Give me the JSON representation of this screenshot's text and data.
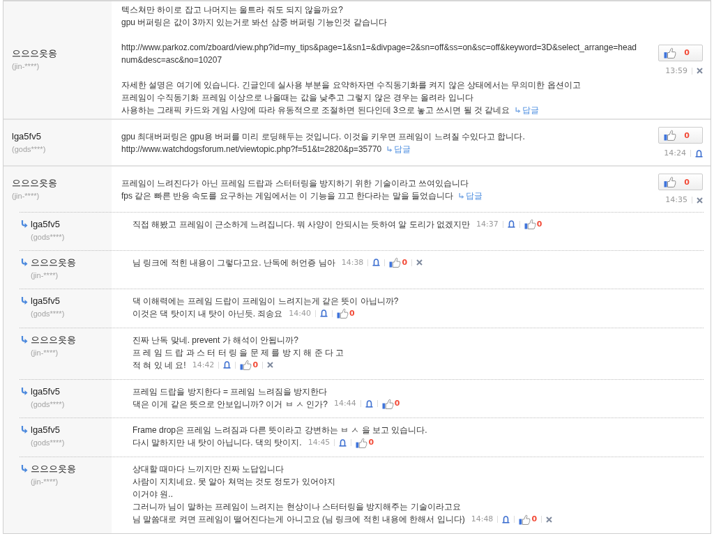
{
  "comments": [
    {
      "author": "으으으읏응",
      "user_id": "(jin-****)",
      "paragraphs": [
        [
          "텍스쳐만 하이로 잡고 나머지는 울트라 줘도 되지 않을까요?",
          "gpu 버퍼링은 값이 3까지 있는거로 봐선 삼중 버퍼링 기능인것 같습니다"
        ],
        [
          "http://www.parkoz.com/zboard/view.php?id=my_tips&page=1&sn1=&divpage=2&sn=off&ss=on&sc=off&keyword=3D&select_arrange=headnum&desc=asc&no=10207"
        ],
        [
          "자세한 설명은 여기에 있습니다. 긴글인데 실사용 부분을 요약하자면 수직동기화를 켜지 않은 상태에서는 무의미한 옵션이고",
          "프레임이 수직동기화 프레임 이상으로 나올때는 값을 낮추고 그렇지 않은 경우는 올려라 입니다",
          "사용하는 그래픽 카드와 게임 사양에 따라 유동적으로 조절하면 된다인데 3으로 놓고 쓰시면 될 것 같네요"
        ]
      ],
      "reply_label": "답글",
      "likes": "0",
      "time": "13:59",
      "can_report": false,
      "can_delete": true
    },
    {
      "author": "lga5fv5",
      "user_id": "(gods****)",
      "paragraphs": [
        [
          "gpu 최대버퍼링은 gpu용 버퍼를 미리 로딩해두는 것입니다. 이것을 키우면 프레임이 느려질 수있다고 합니다.",
          "http://www.watchdogsforum.net/viewtopic.php?f=51&t=2820&p=35770"
        ]
      ],
      "reply_label": "답글",
      "likes": "0",
      "time": "14:24",
      "can_report": true,
      "can_delete": false
    },
    {
      "author": "으으으읏응",
      "user_id": "(jin-****)",
      "paragraphs": [
        [
          "프레임이 느려진다가 아닌 프레임 드랍과 스터터링을 방지하기 위한 기술이라고 쓰여있습니다",
          "fps 같은 빠른 반응 속도를 요구하는 게임에서는 이 기능을 끄고 한다라는 말을 들었습니다"
        ]
      ],
      "reply_label": "답글",
      "likes": "0",
      "time": "14:35",
      "can_report": false,
      "can_delete": true,
      "replies": [
        {
          "author": "lga5fv5",
          "user_id": "(gods****)",
          "lines": [
            "직접 해봤고 프레임이 근소하게 느려집니다. 뭐 사양이 안되시는 듯하여 알 도리가 없겠지만"
          ],
          "time": "14:37",
          "likes": "0",
          "can_report": true,
          "can_delete": false
        },
        {
          "author": "으으으읏응",
          "user_id": "(jin-****)",
          "lines": [
            "님 링크에 적힌 내용이 그렇다고요. 난독에 허언증 님아"
          ],
          "time": "14:38",
          "likes": "0",
          "can_report": true,
          "can_delete": true
        },
        {
          "author": "lga5fv5",
          "user_id": "(gods****)",
          "lines": [
            "댁 이해력에는 프레임 드랍이 프레임이 느려지는게 같은 뜻이 아닙니까?",
            "이것은 댁 탓이지 내 탓이 아닌듯. 죄송요"
          ],
          "time": "14:40",
          "likes": "0",
          "can_report": true,
          "can_delete": false
        },
        {
          "author": "으으으읏응",
          "user_id": "(jin-****)",
          "lines": [
            "진짜 난독 맞네. prevent 가 해석이 안됩니까?",
            "프 레 임 드 랍 과 스 터 터 링 을 문 제 를 방 지 해 준 다 고",
            "적 혀 있 네 요!"
          ],
          "time": "14:42",
          "likes": "0",
          "can_report": true,
          "can_delete": true
        },
        {
          "author": "lga5fv5",
          "user_id": "(gods****)",
          "lines": [
            "프레임 드랍을 방지한다 = 프레임 느려짐을 방지한다",
            "댁은 이게 같은 뜻으로 안보입니까? 이거 ㅂ ㅅ 인가?"
          ],
          "time": "14:44",
          "likes": "0",
          "can_report": true,
          "can_delete": false
        },
        {
          "author": "lga5fv5",
          "user_id": "(gods****)",
          "lines": [
            "Frame drop은 프레임 느려짐과 다른 뜻이라고 강변하는 ㅂ ㅅ 을 보고 있습니다.",
            "다시 말하지만 내 탓이 아닙니다. 댁의 탓이지."
          ],
          "time": "14:45",
          "likes": "0",
          "can_report": true,
          "can_delete": false
        },
        {
          "author": "으으으읏응",
          "user_id": "(jin-****)",
          "lines": [
            "상대할 때마다 느끼지만 진짜 노답입니다",
            "사람이 지치네요. 못 알아 쳐먹는 것도 정도가 있어야지",
            "이거야 원..",
            "그러니까 님이 말하는 프레임이 느려지는 현상이나 스터터링을 방지해주는 기술이라고요",
            "님 말씀대로 켜면 프레임이 떨어진다는게 아니고요 (님 링크에 적힌 내용에 한해서 입니다)"
          ],
          "time": "14:48",
          "likes": "0",
          "can_report": true,
          "can_delete": true
        }
      ]
    }
  ]
}
